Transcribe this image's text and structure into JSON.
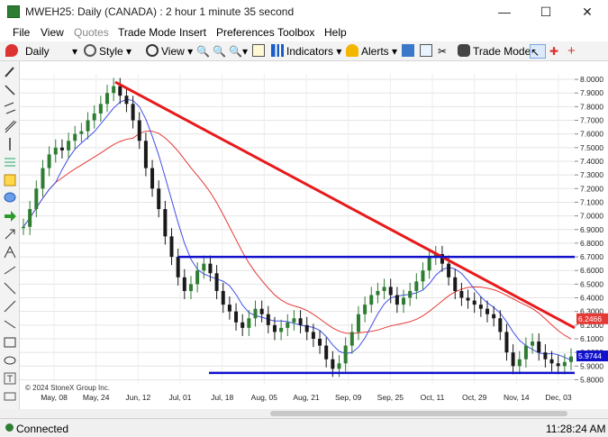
{
  "window": {
    "title": "MWEH25: Daily (CANADA) : 2 hour 1 minute 35 second"
  },
  "menu": [
    "File",
    "View",
    "Quotes",
    "Trade Mode",
    "Insert",
    "Preferences",
    "Toolbox",
    "Help"
  ],
  "toolbar": {
    "interval": "Daily",
    "style_label": "Style",
    "view_label": "View",
    "indicators_label": "Indicators",
    "alerts_label": "Alerts",
    "trade_mode_label": "Trade Mode"
  },
  "status": {
    "connection": "Connected",
    "time": "11:28:24 AM"
  },
  "colors": {
    "up": "#2e7d32",
    "down": "#1a1a1a",
    "ma_fast": "#3f51e8",
    "ma_slow": "#e53935",
    "trend": "#e8191a",
    "support": "#1111cc"
  },
  "chart_data": {
    "type": "candlestick",
    "copyright": "© 2024 StoneX Group Inc.",
    "x_labels": [
      "May, 08",
      "May, 24",
      "Jun, 12",
      "Jul, 01",
      "Jul, 18",
      "Aug, 05",
      "Aug, 21",
      "Sep, 09",
      "Sep, 25",
      "Oct, 11",
      "Oct, 29",
      "Nov, 14",
      "Dec, 03"
    ],
    "y_labels": [
      "8.0000",
      "7.9000",
      "7.8000",
      "7.7000",
      "7.6000",
      "7.5000",
      "7.4000",
      "7.3000",
      "7.2000",
      "7.1000",
      "7.0000",
      "6.9000",
      "6.8000",
      "6.7000",
      "6.6000",
      "6.5000",
      "6.4000",
      "6.3000",
      "6.2000",
      "6.1000",
      "6.0000",
      "5.9000",
      "5.8000"
    ],
    "ylim": [
      5.77,
      8.04
    ],
    "last_price": "5.9744",
    "ma_value": "6.2466",
    "closes": [
      6.92,
      7.05,
      7.2,
      7.35,
      7.45,
      7.5,
      7.48,
      7.55,
      7.6,
      7.62,
      7.7,
      7.75,
      7.82,
      7.9,
      7.95,
      7.88,
      7.82,
      7.7,
      7.55,
      7.35,
      7.2,
      7.05,
      6.85,
      6.7,
      6.55,
      6.45,
      6.5,
      6.6,
      6.65,
      6.58,
      6.45,
      6.35,
      6.3,
      6.22,
      6.18,
      6.25,
      6.32,
      6.28,
      6.2,
      6.15,
      6.18,
      6.22,
      6.25,
      6.2,
      6.15,
      6.1,
      6.05,
      5.95,
      5.88,
      5.92,
      6.05,
      6.15,
      6.28,
      6.35,
      6.42,
      6.45,
      6.48,
      6.42,
      6.35,
      6.4,
      6.45,
      6.52,
      6.6,
      6.7,
      6.72,
      6.65,
      6.55,
      6.45,
      6.4,
      6.38,
      6.35,
      6.32,
      6.28,
      6.25,
      6.15,
      6.0,
      5.9,
      5.95,
      6.05,
      6.08,
      6.0,
      5.95,
      5.92,
      5.9,
      5.93,
      5.97
    ]
  }
}
